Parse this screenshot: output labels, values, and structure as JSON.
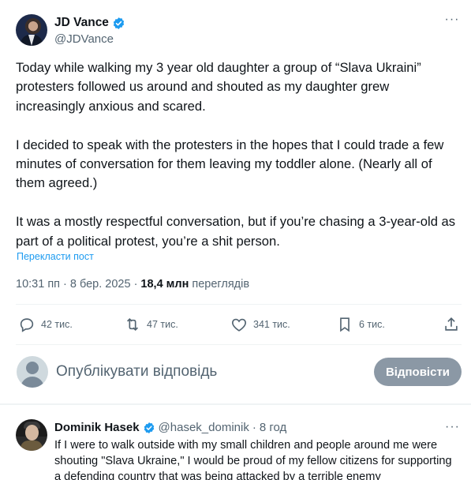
{
  "tweet": {
    "author_name": "JD Vance",
    "author_handle": "@JDVance",
    "more_label": "···",
    "paragraphs": [
      "Today while walking my 3 year old daughter a group of “Slava Ukraini” protesters followed us around and shouted as my daughter grew increasingly anxious and scared.",
      "I decided to speak with the protesters in the hopes that I could trade a few minutes of conversation for them leaving my toddler alone. (Nearly all of them agreed.)",
      "It was a mostly respectful conversation,  but if you’re chasing a 3-year-old as part of a political protest, you’re a shit person."
    ],
    "translate_label": "Перекласти пост",
    "time": "10:31 пп",
    "date": "8 бер. 2025",
    "separator": "·",
    "views_count": "18,4 млн",
    "views_label": "переглядів"
  },
  "actions": {
    "replies": "42 тис.",
    "reposts": "47 тис.",
    "likes": "341 тис.",
    "bookmarks": "6 тис."
  },
  "reply_box": {
    "placeholder": "Опублікувати відповідь",
    "button_label": "Відповісти"
  },
  "reply": {
    "author_name": "Dominik Hasek",
    "author_handle": "@hasek_dominik",
    "dot": "·",
    "time": "8 год",
    "more_label": "···",
    "text": "If I were to walk outside with my small children and people around me were shouting \"Slava Ukraine,\" I would be proud of my fellow citizens for supporting a defending country that was being attacked by a terrible enemy"
  },
  "colors": {
    "accent": "#1d9bf0",
    "text_primary": "#0f1419",
    "text_secondary": "#536471",
    "button_disabled": "#8b98a5"
  },
  "icons": [
    "verified-badge-icon",
    "more-icon",
    "reply-icon",
    "repost-icon",
    "like-icon",
    "bookmark-icon",
    "share-icon"
  ]
}
